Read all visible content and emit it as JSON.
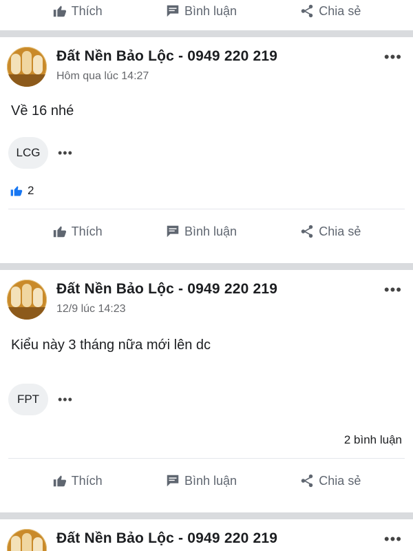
{
  "action_bar": {
    "like_label": "Thích",
    "comment_label": "Bình luận",
    "share_label": "Chia sẻ"
  },
  "posts": [
    {
      "page_name": "Đất Nền Bảo Lộc - 0949 220 219",
      "time": "Hôm qua lúc 14:27",
      "text": "Về 16 nhé",
      "chip": "LCG",
      "like_count": "2"
    },
    {
      "page_name": "Đất Nền Bảo Lộc - 0949 220 219",
      "time": "12/9 lúc 14:23",
      "text": "Kiểu này 3 tháng nữa mới lên dc",
      "chip": "FPT",
      "comment_count": "2 bình luận"
    },
    {
      "page_name": "Đất Nền Bảo Lộc - 0949 220 219"
    }
  ],
  "colors": {
    "separator": "#d9dbde",
    "like_blue": "#1877f2",
    "muted": "#65676b"
  }
}
